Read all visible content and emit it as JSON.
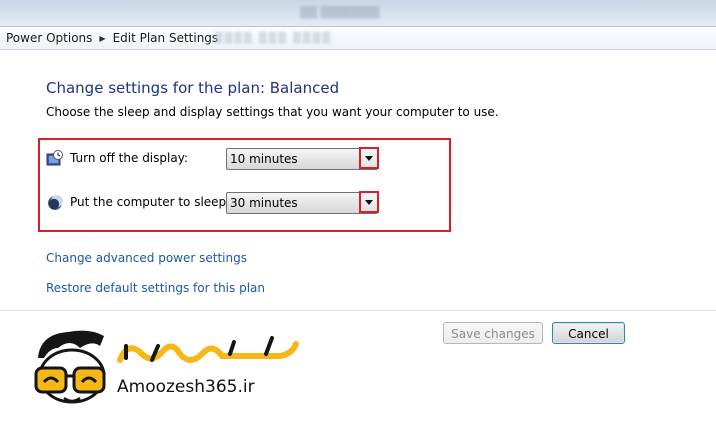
{
  "breadcrumb": {
    "items": [
      "Power Options",
      "Edit Plan Settings"
    ]
  },
  "content": {
    "title": "Change settings for the plan: Balanced",
    "description": "Choose the sleep and display settings that you want your computer to use."
  },
  "settings": {
    "display": {
      "label": "Turn off the display:",
      "value": "10 minutes"
    },
    "sleep": {
      "label": "Put the computer to sleep:",
      "value": "30 minutes"
    }
  },
  "links": {
    "advanced": "Change advanced power settings",
    "restore": "Restore default settings for this plan"
  },
  "buttons": {
    "save": "Save changes",
    "cancel": "Cancel"
  },
  "logo": {
    "brand": "Amoozesh365.ir",
    "script": "آموزش ۳۶۵"
  },
  "colors": {
    "title": "#1e3287",
    "link": "#1c57a8",
    "highlight": "#d71f2b",
    "logo_accent": "#f6b817"
  }
}
